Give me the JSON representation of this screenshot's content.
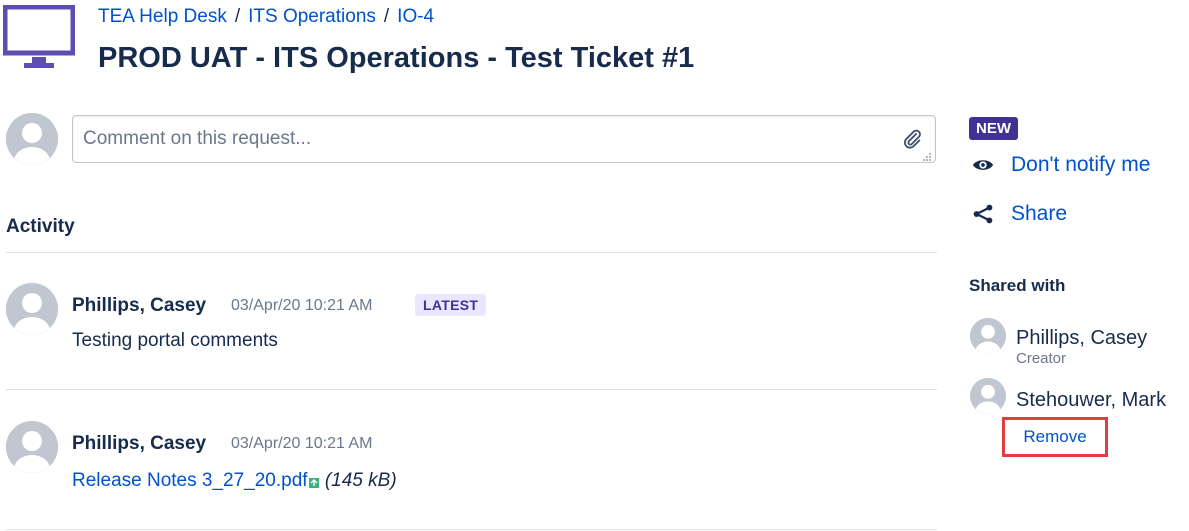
{
  "header": {
    "breadcrumbs": [
      "TEA Help Desk",
      "ITS Operations",
      "IO-4"
    ],
    "title": "PROD UAT - ITS Operations - Test Ticket #1"
  },
  "comment": {
    "placeholder": "Comment on this request..."
  },
  "activity": {
    "heading": "Activity",
    "entries": [
      {
        "author": "Phillips, Casey",
        "time": "03/Apr/20 10:21 AM",
        "badge": "LATEST",
        "text": "Testing portal comments"
      },
      {
        "author": "Phillips, Casey",
        "time": "03/Apr/20 10:21 AM",
        "attachment": {
          "name": "Release Notes 3_27_20.pdf",
          "size": "(145 kB)"
        }
      }
    ]
  },
  "sidebar": {
    "status": "NEW",
    "notify_label": "Don't notify me",
    "share_label": "Share",
    "shared_heading": "Shared with",
    "shared": [
      {
        "name": "Phillips, Casey",
        "role": "Creator"
      },
      {
        "name": "Stehouwer, Mark",
        "action": "Remove"
      }
    ]
  },
  "colors": {
    "link": "#0052cc",
    "status_new": "#403294",
    "latest_bg": "#eae6ff",
    "highlight_box": "#e03e3e",
    "project_icon": "#5e4db2"
  },
  "icons": [
    "monitor-icon",
    "paperclip-icon",
    "eye-icon",
    "share-icon",
    "user-avatar-icon",
    "pdf-file-icon"
  ]
}
